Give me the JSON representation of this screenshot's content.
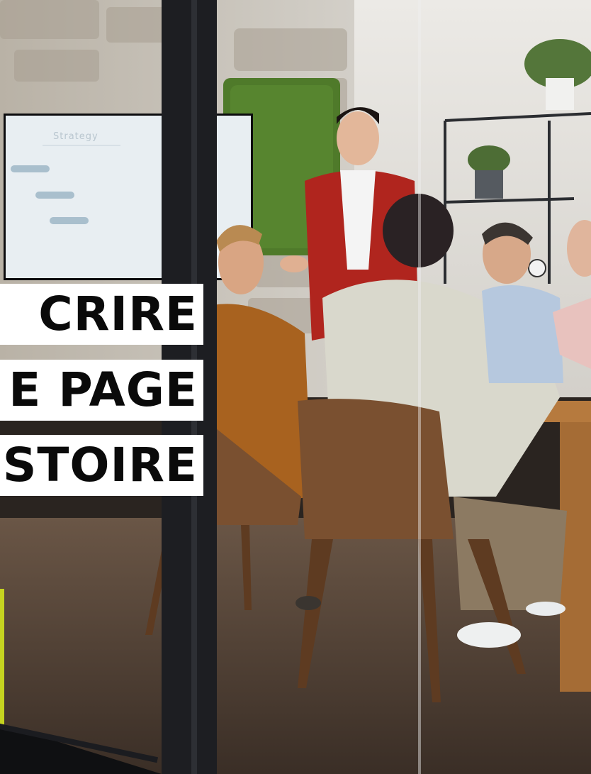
{
  "headline": {
    "line1": "CRIRE",
    "line2": "E PAGE",
    "line3": "STOIRE"
  },
  "screen": {
    "label": "Strategy"
  },
  "colors": {
    "banner_bg": "#ffffff",
    "banner_text": "#0a0a0a",
    "accent_green": "#c5d320",
    "jacket_red": "#b0251e",
    "moss": "#4f7a2a",
    "table_wood": "#b67a3e"
  }
}
